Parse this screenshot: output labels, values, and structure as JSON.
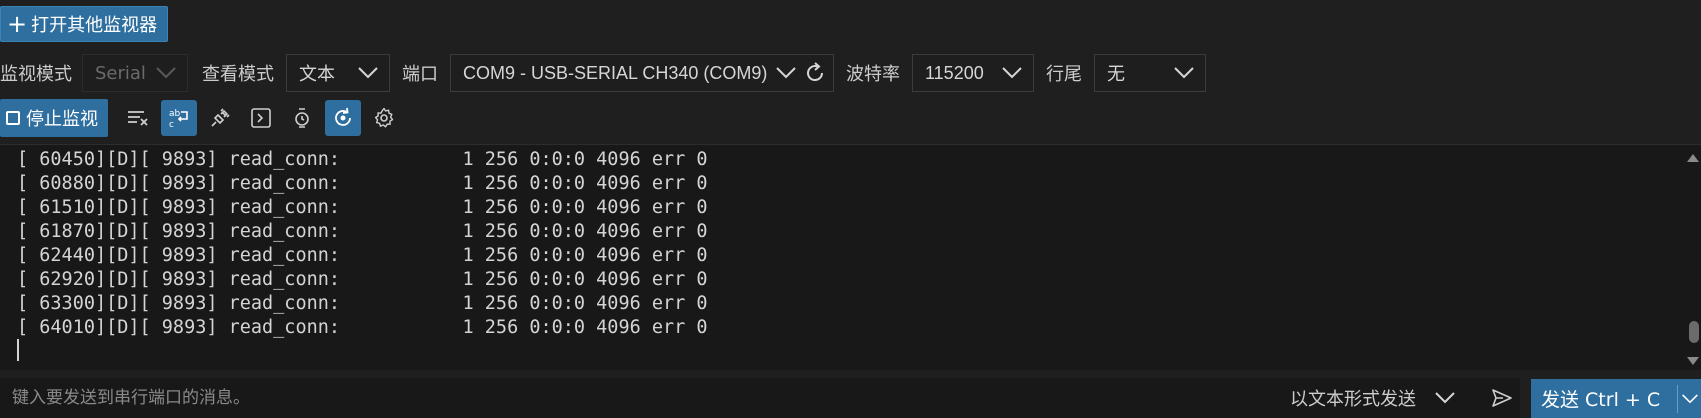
{
  "header": {
    "open_monitor_label": "打开其他监视器"
  },
  "settings": {
    "monitor_mode_label": "监视模式",
    "monitor_mode_value": "Serial",
    "view_mode_label": "查看模式",
    "view_mode_value": "文本",
    "port_label": "端口",
    "port_value": "COM9 - USB-SERIAL CH340 (COM9)",
    "baud_label": "波特率",
    "baud_value": "115200",
    "line_ending_label": "行尾",
    "line_ending_value": "无"
  },
  "toolbar": {
    "stop_label": "停止监视",
    "icons": [
      "clear-output-icon",
      "word-wrap-icon",
      "plug-icon",
      "terminal-icon",
      "timestamp-icon",
      "auto-scroll-icon",
      "settings-gear-icon"
    ]
  },
  "log": {
    "lines": [
      "[ 60450][D][ 9893] read_conn:           1 256 0:0:0 4096 err 0",
      "[ 60880][D][ 9893] read_conn:           1 256 0:0:0 4096 err 0",
      "[ 61510][D][ 9893] read_conn:           1 256 0:0:0 4096 err 0",
      "[ 61870][D][ 9893] read_conn:           1 256 0:0:0 4096 err 0",
      "[ 62440][D][ 9893] read_conn:           1 256 0:0:0 4096 err 0",
      "[ 62920][D][ 9893] read_conn:           1 256 0:0:0 4096 err 0",
      "[ 63300][D][ 9893] read_conn:           1 256 0:0:0 4096 err 0",
      "[ 64010][D][ 9893] read_conn:           1 256 0:0:0 4096 err 0"
    ]
  },
  "send": {
    "placeholder": "键入要发送到串行端口的消息。",
    "value": "",
    "format_label": "以文本形式发送",
    "button_label": "发送 Ctrl + C"
  },
  "colors": {
    "accent": "#2f6f9f",
    "background": "#1f1f1f",
    "output_background": "#181818"
  }
}
